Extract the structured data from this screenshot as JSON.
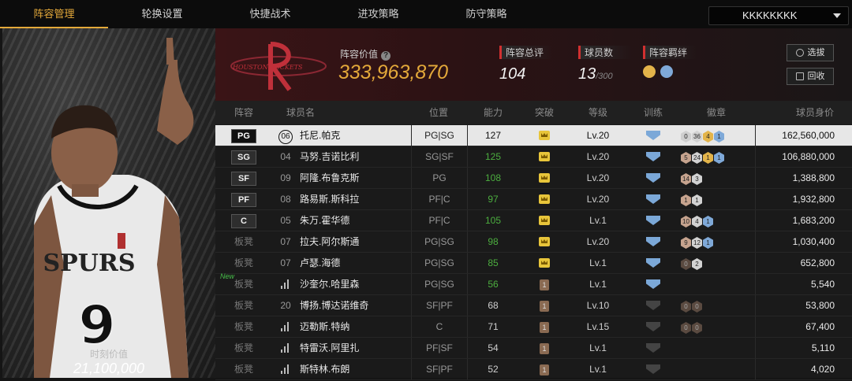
{
  "nav": {
    "tabs": [
      "阵容管理",
      "轮换设置",
      "快捷战术",
      "进攻策略",
      "防守策略"
    ],
    "active": 0,
    "account": "KKKKKKKK"
  },
  "player_card": {
    "value_label": "时刻价值",
    "value": "21,100,000",
    "jersey_number": "9",
    "jersey_text": "SPURS"
  },
  "team": {
    "logo_text": "HOUSTON ROCKETS",
    "value_label": "阵容价值",
    "value": "333,963,870",
    "rating_label": "阵容总评",
    "rating": "104",
    "count_label": "球员数",
    "count": "13",
    "count_max": "/300",
    "bond_label": "阵容羁绊",
    "btn_select": "选拔",
    "btn_recycle": "回收"
  },
  "table": {
    "headers": [
      "阵容",
      "球员名",
      "位置",
      "能力",
      "突破",
      "等级",
      "训练",
      "徽章",
      "球员身价"
    ],
    "rows": [
      {
        "slot": "PG",
        "starter": true,
        "no": "06",
        "name": "托尼.帕克",
        "pos": "PG|SG",
        "ability": "127",
        "green": false,
        "brk": "crown",
        "level": "Lv.20",
        "train": true,
        "badges": [
          [
            "0",
            "gr"
          ],
          [
            "36",
            "si"
          ],
          [
            "4",
            "go"
          ],
          [
            "1",
            "bl"
          ]
        ],
        "value": "162,560,000",
        "selected": true
      },
      {
        "slot": "SG",
        "starter": true,
        "no": "04",
        "name": "马努.吉诺比利",
        "pos": "SG|SF",
        "ability": "125",
        "green": true,
        "brk": "crown",
        "level": "Lv.20",
        "train": true,
        "badges": [
          [
            "5",
            "br"
          ],
          [
            "24",
            "si"
          ],
          [
            "1",
            "go"
          ],
          [
            "1",
            "bl"
          ]
        ],
        "value": "106,880,000"
      },
      {
        "slot": "SF",
        "starter": true,
        "no": "09",
        "name": "阿隆.布鲁克斯",
        "pos": "PG",
        "ability": "108",
        "green": true,
        "brk": "crown",
        "level": "Lv.20",
        "train": true,
        "badges": [
          [
            "14",
            "br"
          ],
          [
            "3",
            "si"
          ]
        ],
        "value": "1,388,800"
      },
      {
        "slot": "PF",
        "starter": true,
        "no": "08",
        "name": "路易斯.斯科拉",
        "pos": "PF|C",
        "ability": "97",
        "green": true,
        "brk": "crown",
        "level": "Lv.20",
        "train": true,
        "badges": [
          [
            "1",
            "br"
          ],
          [
            "1",
            "si"
          ]
        ],
        "value": "1,932,800"
      },
      {
        "slot": "C",
        "starter": true,
        "no": "05",
        "name": "朱万.霍华德",
        "pos": "PF|C",
        "ability": "105",
        "green": true,
        "brk": "crown",
        "level": "Lv.1",
        "train": true,
        "badges": [
          [
            "10",
            "br"
          ],
          [
            "4",
            "si"
          ],
          [
            "1",
            "bl"
          ]
        ],
        "value": "1,683,200"
      },
      {
        "slot": "板凳",
        "starter": false,
        "no": "07",
        "name": "拉夫.阿尔斯通",
        "pos": "PG|SG",
        "ability": "98",
        "green": true,
        "brk": "crown",
        "level": "Lv.20",
        "train": true,
        "badges": [
          [
            "9",
            "br"
          ],
          [
            "12",
            "si"
          ],
          [
            "1",
            "bl"
          ]
        ],
        "value": "1,030,400"
      },
      {
        "slot": "板凳",
        "starter": false,
        "no": "07",
        "name": "卢瑟.海德",
        "pos": "PG|SG",
        "ability": "85",
        "green": true,
        "brk": "crown",
        "level": "Lv.1",
        "train": true,
        "badges": [
          [
            "0",
            "dk"
          ],
          [
            "2",
            "si"
          ]
        ],
        "value": "652,800"
      },
      {
        "slot": "板凳",
        "starter": false,
        "isnew": true,
        "new": "New",
        "no": "",
        "bars": true,
        "name": "沙奎尔.哈里森",
        "pos": "PG|SG",
        "ability": "56",
        "green": true,
        "brk": "1",
        "level": "Lv.1",
        "train": true,
        "badges": [],
        "value": "5,540"
      },
      {
        "slot": "板凳",
        "starter": false,
        "no": "20",
        "name": "博扬.博达诺维奇",
        "pos": "SF|PF",
        "ability": "68",
        "green": false,
        "brk": "1",
        "level": "Lv.10",
        "train": false,
        "badges": [
          [
            "0",
            "dk"
          ],
          [
            "0",
            "dk"
          ]
        ],
        "value": "53,800"
      },
      {
        "slot": "板凳",
        "starter": false,
        "no": "",
        "bars": true,
        "name": "迈勒斯.特纳",
        "pos": "C",
        "ability": "71",
        "green": false,
        "brk": "1",
        "level": "Lv.15",
        "train": false,
        "badges": [
          [
            "0",
            "dk"
          ],
          [
            "0",
            "dk"
          ]
        ],
        "value": "67,400"
      },
      {
        "slot": "板凳",
        "starter": false,
        "no": "",
        "bars": true,
        "name": "特雷沃.阿里扎",
        "pos": "PF|SF",
        "ability": "54",
        "green": false,
        "brk": "1",
        "level": "Lv.1",
        "train": false,
        "badges": [],
        "value": "5,110"
      },
      {
        "slot": "板凳",
        "starter": false,
        "no": "",
        "bars": true,
        "name": "斯特林.布朗",
        "pos": "SF|PF",
        "ability": "52",
        "green": false,
        "brk": "1",
        "level": "Lv.1",
        "train": false,
        "badges": [],
        "value": "4,020"
      }
    ]
  },
  "colors": {
    "accent": "#e4a93a",
    "green": "#4cae3f",
    "red": "#d03030"
  }
}
